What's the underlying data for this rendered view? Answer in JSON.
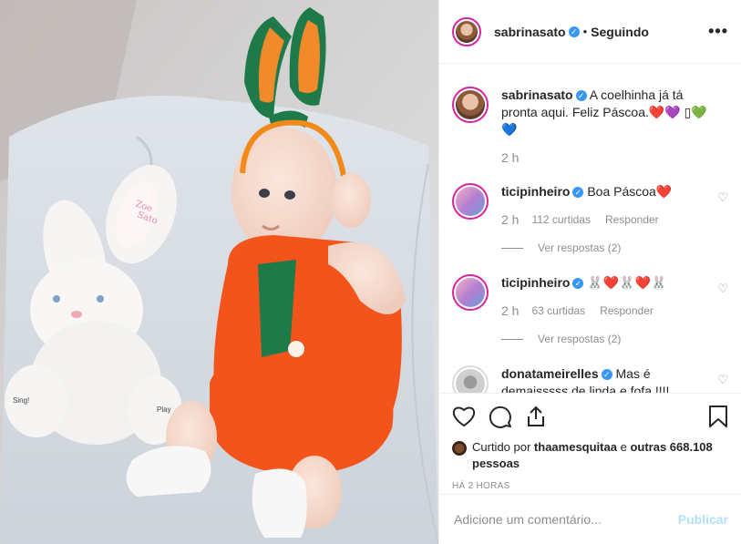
{
  "header": {
    "username": "sabrinasato",
    "separator": "•",
    "follow_label": "Seguindo",
    "more_label": "•••"
  },
  "caption": {
    "username": "sabrinasato",
    "text": "A coelhinha já tá pronta aqui. Feliz Páscoa.❤️💜 ▯💚💙",
    "time": "2 h"
  },
  "comments": [
    {
      "username": "ticipinheiro",
      "text": "Boa Páscoa❤️",
      "time": "2 h",
      "likes": "112 curtidas",
      "reply_label": "Responder",
      "view_replies": "Ver respostas (2)"
    },
    {
      "username": "ticipinheiro",
      "text": "🐰❤️🐰❤️🐰",
      "time": "2 h",
      "likes": "63 curtidas",
      "reply_label": "Responder",
      "view_replies": "Ver respostas (2)"
    },
    {
      "username": "donatameirelles",
      "text": "Mas é demaisssss de linda e fofa !!!!"
    }
  ],
  "likes": {
    "prefix": "Curtido por ",
    "user": "thaamesquitaa",
    "middle": " e ",
    "others": "outras 668.108 pessoas"
  },
  "posted_time": "HÁ 2 HORAS",
  "comment_box": {
    "placeholder": "Adicione um comentário...",
    "publish_label": "Publicar"
  },
  "photo": {
    "toy_label_1": "Zoe",
    "toy_label_2": "Sato",
    "foot_label_left": "Sing!",
    "foot_label_right": "Play"
  },
  "colors": {
    "accent": "#3897f0",
    "carrot": "#f2541b",
    "stem": "#1f7a4a",
    "publish_disabled": "#b2dffc"
  }
}
